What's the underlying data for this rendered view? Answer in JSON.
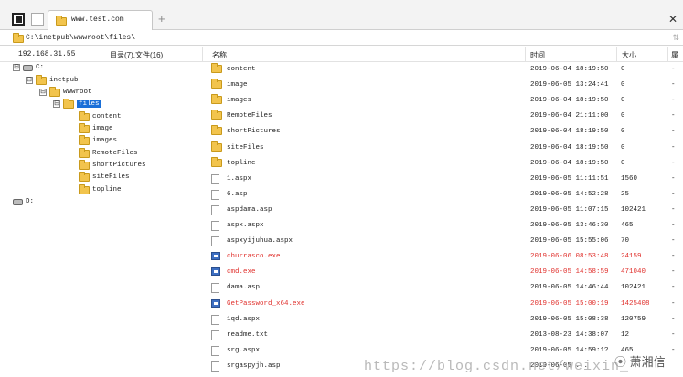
{
  "tab": {
    "label": "www.test.com",
    "new_tab": "+"
  },
  "window": {
    "close": "✕"
  },
  "address": {
    "path": "C:\\inetpub\\wwwroot\\files\\",
    "arrows": "⇅"
  },
  "header": {
    "ip": "192.168.31.55",
    "counts": "目录(7),文件(16)",
    "col_name": "名称",
    "col_time": "时间",
    "col_size": "大小",
    "col_attr": "属"
  },
  "tree": [
    {
      "label": "C:",
      "kind": "drive",
      "expander": "⊟",
      "level": 0
    },
    {
      "label": "inetpub",
      "kind": "folder",
      "expander": "⊟",
      "level": 1
    },
    {
      "label": "wwwroot",
      "kind": "folder",
      "expander": "⊟",
      "level": 2
    },
    {
      "label": "files",
      "kind": "folder",
      "expander": "⊟",
      "level": 3,
      "selected": true
    },
    {
      "label": "content",
      "kind": "folder",
      "level": 4
    },
    {
      "label": "image",
      "kind": "folder",
      "level": 4
    },
    {
      "label": "images",
      "kind": "folder",
      "level": 4
    },
    {
      "label": "RemoteFiles",
      "kind": "folder",
      "level": 4
    },
    {
      "label": "shortPictures",
      "kind": "folder",
      "level": 4
    },
    {
      "label": "siteFiles",
      "kind": "folder",
      "level": 4
    },
    {
      "label": "topline",
      "kind": "folder",
      "level": 4
    },
    {
      "label": "D:",
      "kind": "drive",
      "level": 0,
      "gap": true
    }
  ],
  "files": [
    {
      "name": "content",
      "time": "2019-06-04 18:19:50",
      "size": "0",
      "attr": "-",
      "type": "folder"
    },
    {
      "name": "image",
      "time": "2019-06-05 13:24:41",
      "size": "0",
      "attr": "-",
      "type": "folder"
    },
    {
      "name": "images",
      "time": "2019-06-04 18:19:50",
      "size": "0",
      "attr": "-",
      "type": "folder"
    },
    {
      "name": "RemoteFiles",
      "time": "2019-06-04 21:11:00",
      "size": "0",
      "attr": "-",
      "type": "folder"
    },
    {
      "name": "shortPictures",
      "time": "2019-06-04 18:19:50",
      "size": "0",
      "attr": "-",
      "type": "folder"
    },
    {
      "name": "siteFiles",
      "time": "2019-06-04 18:19:50",
      "size": "0",
      "attr": "-",
      "type": "folder"
    },
    {
      "name": "topline",
      "time": "2019-06-04 18:19:50",
      "size": "0",
      "attr": "-",
      "type": "folder"
    },
    {
      "name": "1.aspx",
      "time": "2019-06-05 11:11:51",
      "size": "1560",
      "attr": "-",
      "type": "file"
    },
    {
      "name": "6.asp",
      "time": "2019-06-05 14:52:28",
      "size": "25",
      "attr": "-",
      "type": "file"
    },
    {
      "name": "aspdama.asp",
      "time": "2019-06-05 11:07:15",
      "size": "102421",
      "attr": "-",
      "type": "file"
    },
    {
      "name": "aspx.aspx",
      "time": "2019-06-05 13:46:30",
      "size": "465",
      "attr": "-",
      "type": "file"
    },
    {
      "name": "aspxyijuhua.aspx",
      "time": "2019-06-05 15:55:06",
      "size": "70",
      "attr": "-",
      "type": "file"
    },
    {
      "name": "churrasco.exe",
      "time": "2019-06-06 08:53:48",
      "size": "24159",
      "attr": "-",
      "type": "exe",
      "highlight": true
    },
    {
      "name": "cmd.exe",
      "time": "2019-06-05 14:58:59",
      "size": "471040",
      "attr": "-",
      "type": "exe",
      "highlight": true
    },
    {
      "name": "dama.asp",
      "time": "2019-06-05 14:46:44",
      "size": "102421",
      "attr": "-",
      "type": "file"
    },
    {
      "name": "GetPassword_x64.exe",
      "time": "2019-06-05 15:00:19",
      "size": "1425408",
      "attr": "-",
      "type": "exe",
      "highlight": true
    },
    {
      "name": "1qd.aspx",
      "time": "2019-06-05 15:08:38",
      "size": "120759",
      "attr": "-",
      "type": "file"
    },
    {
      "name": "readme.txt",
      "time": "2013-08-23 14:38:07",
      "size": "12",
      "attr": "-",
      "type": "file"
    },
    {
      "name": "srg.aspx",
      "time": "2019-06-05 14:59:1?",
      "size": "465",
      "attr": "-",
      "type": "file"
    },
    {
      "name": "srgaspyjh.asp",
      "time": "2019-06-05 ...",
      "size": "",
      "attr": "",
      "type": "file"
    }
  ],
  "watermark": {
    "text": "https://blog.csdn.net/weixin_",
    "badge": "萧湘信"
  }
}
